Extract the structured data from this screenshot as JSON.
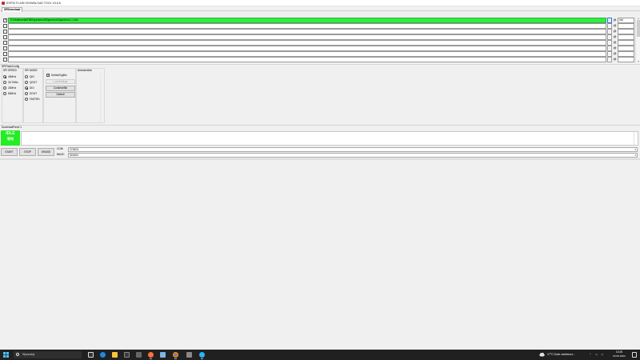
{
  "window": {
    "title": "ESP32 FLASH DOWNLOAD TOOL V3.6.6"
  },
  "tabs": [
    {
      "label": "SPIDownload"
    }
  ],
  "file_rows": [
    {
      "checked": true,
      "path": "D:\\Multimedia\\Fill\\Esperimenti\\Spectrum\\Spectrum-1.1.bin",
      "address": "0x0",
      "at": "@"
    },
    {
      "checked": false,
      "path": "",
      "address": "",
      "at": "@"
    },
    {
      "checked": false,
      "path": "",
      "address": "",
      "at": "@"
    },
    {
      "checked": false,
      "path": "",
      "address": "",
      "at": "@"
    },
    {
      "checked": false,
      "path": "",
      "address": "",
      "at": "@"
    },
    {
      "checked": false,
      "path": "",
      "address": "",
      "at": "@"
    },
    {
      "checked": false,
      "path": "",
      "address": "",
      "at": "@"
    },
    {
      "checked": false,
      "path": "",
      "address": "",
      "at": "@"
    }
  ],
  "browse_label": "...",
  "spi_flash_config": {
    "title": "SPIFlashConfig",
    "spi_speed": {
      "title": "SPI SPEED",
      "options": [
        "40MHz",
        "26.7MHz",
        "20MHz",
        "80MHz"
      ],
      "selected": "40MHz"
    },
    "spi_mode": {
      "title": "SPI MODE",
      "options": [
        "QIO",
        "QOUT",
        "DIO",
        "DOUT",
        "FASTRD"
      ],
      "selected": "DIO"
    },
    "do_not_chg_bin": {
      "label": "DoNotChgBin",
      "checked": true
    },
    "lock_settings": {
      "label": "LockSettings",
      "enabled": false
    },
    "combine_bin_label": "CombineBin",
    "default_label": "Default",
    "detected_info": {
      "title": "DetectedInfo"
    }
  },
  "download_panel": {
    "title": "DownloadPanel 1",
    "status": "IDLE",
    "status_sub": "等待",
    "progress": 0,
    "start_label": "START",
    "stop_label": "STOP",
    "erase_label": "ERASE",
    "com_label": "COM:",
    "com_value": "COM13",
    "baud_label": "BAUD:",
    "baud_value": "921600"
  },
  "taskbar": {
    "search_placeholder": "Wyszukaj",
    "weather_temp": "17°C",
    "weather_text": "Duże zachmurz...",
    "time": "10:25",
    "date": "02.06.2024"
  },
  "colors": {
    "status_green": "#22ee22",
    "selected_path_green": "#2eee3e",
    "taskbar_bg": "#202020"
  },
  "icons": {
    "app": "espressif-logo-icon",
    "start": "windows-start-icon",
    "search": "search-icon",
    "weather": "cloud-icon",
    "notifications": "notification-icon"
  }
}
